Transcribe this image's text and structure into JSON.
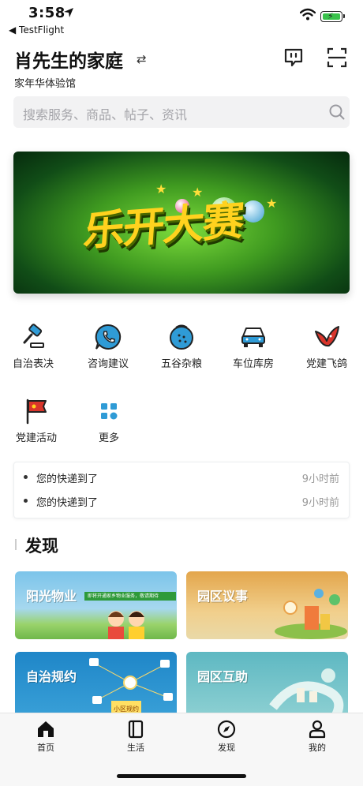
{
  "status_bar": {
    "time": "3:58",
    "back_app": "◀ TestFlight"
  },
  "header": {
    "family_name": "肖先生的家庭",
    "swap_glyph": "⇄",
    "community": "家年华体验馆"
  },
  "search": {
    "placeholder": "搜索服务、商品、帖子、资讯"
  },
  "banner": {
    "text": "乐开大赛"
  },
  "services": [
    {
      "label": "自治表决",
      "icon": "gavel-icon"
    },
    {
      "label": "咨询建议",
      "icon": "phone-chat-icon"
    },
    {
      "label": "五谷杂粮",
      "icon": "grain-icon"
    },
    {
      "label": "车位库房",
      "icon": "car-icon"
    },
    {
      "label": "党建飞鸽",
      "icon": "dove-icon"
    },
    {
      "label": "党建活动",
      "icon": "flag-icon"
    },
    {
      "label": "更多",
      "icon": "grid-icon"
    }
  ],
  "notices": [
    {
      "text": "您的快递到了",
      "time": "9小时前"
    },
    {
      "text": "您的快递到了",
      "time": "9小时前"
    }
  ],
  "discover": {
    "title": "发现",
    "cards": [
      {
        "title": "阳光物业",
        "banner_note": "即将开通家乡物业服务，敬请期待"
      },
      {
        "title": "园区议事"
      },
      {
        "title": "自治规约",
        "tag": "小区规约"
      },
      {
        "title": "园区互助"
      }
    ]
  },
  "tabs": [
    {
      "label": "首页",
      "icon": "home-icon"
    },
    {
      "label": "生活",
      "icon": "book-icon"
    },
    {
      "label": "发现",
      "icon": "compass-icon"
    },
    {
      "label": "我的",
      "icon": "user-icon"
    }
  ],
  "colors": {
    "accent_blue": "#2f9bd6",
    "party_red": "#d9352b",
    "card_orange": "#e9b85f",
    "card_teal": "#76c3c9"
  }
}
